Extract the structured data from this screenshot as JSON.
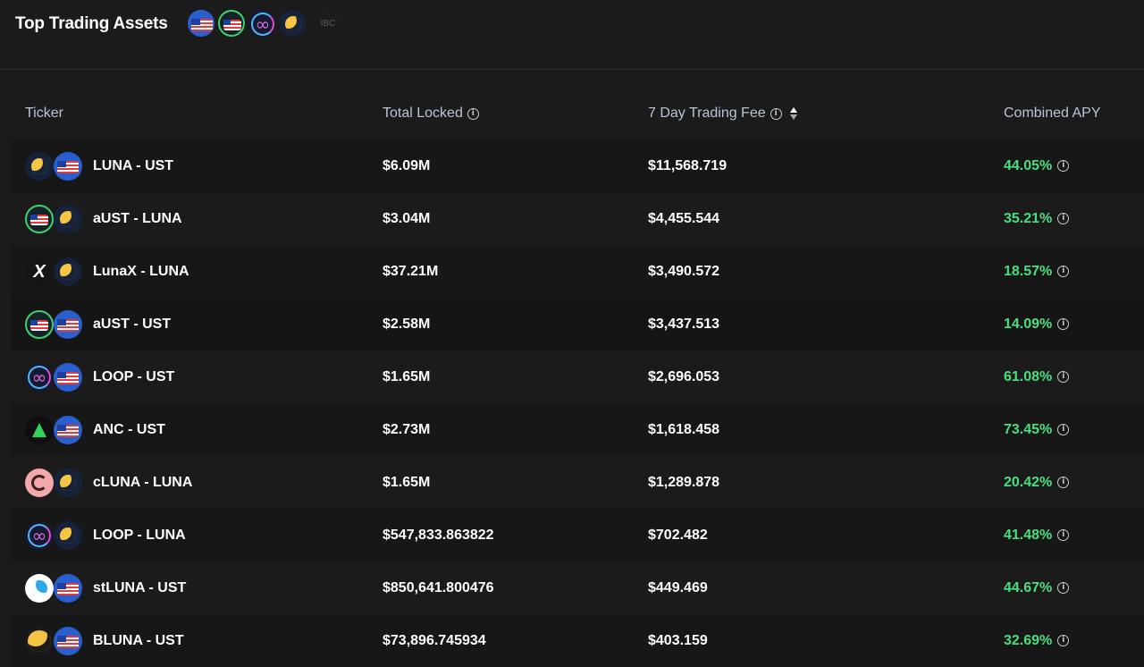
{
  "header": {
    "title": "Top Trading Assets",
    "icons": [
      "ust-icon",
      "aust-icon",
      "loop-icon",
      "luna-icon"
    ],
    "ibc_label": "IBC"
  },
  "table": {
    "columns": {
      "ticker": "Ticker",
      "total_locked": "Total Locked",
      "trading_fee": "7 Day Trading Fee",
      "combined_apy": "Combined APY"
    },
    "rows": [
      {
        "icons": [
          "luna",
          "ust"
        ],
        "ticker": "LUNA - UST",
        "total_locked": "$6.09M",
        "trading_fee": "$11,568.719",
        "apy": "44.05%"
      },
      {
        "icons": [
          "aust",
          "luna"
        ],
        "ticker": "aUST - LUNA",
        "total_locked": "$3.04M",
        "trading_fee": "$4,455.544",
        "apy": "35.21%"
      },
      {
        "icons": [
          "lunax",
          "luna"
        ],
        "ticker": "LunaX - LUNA",
        "total_locked": "$37.21M",
        "trading_fee": "$3,490.572",
        "apy": "18.57%"
      },
      {
        "icons": [
          "aust",
          "ust"
        ],
        "ticker": "aUST - UST",
        "total_locked": "$2.58M",
        "trading_fee": "$3,437.513",
        "apy": "14.09%"
      },
      {
        "icons": [
          "loop",
          "ust"
        ],
        "ticker": "LOOP - UST",
        "total_locked": "$1.65M",
        "trading_fee": "$2,696.053",
        "apy": "61.08%"
      },
      {
        "icons": [
          "anc",
          "ust"
        ],
        "ticker": "ANC - UST",
        "total_locked": "$2.73M",
        "trading_fee": "$1,618.458",
        "apy": "73.45%"
      },
      {
        "icons": [
          "cluna",
          "luna"
        ],
        "ticker": "cLUNA - LUNA",
        "total_locked": "$1.65M",
        "trading_fee": "$1,289.878",
        "apy": "20.42%"
      },
      {
        "icons": [
          "loop",
          "luna"
        ],
        "ticker": "LOOP - LUNA",
        "total_locked": "$547,833.863822",
        "trading_fee": "$702.482",
        "apy": "41.48%"
      },
      {
        "icons": [
          "stluna",
          "ust"
        ],
        "ticker": "stLUNA - UST",
        "total_locked": "$850,641.800476",
        "trading_fee": "$449.469",
        "apy": "44.67%"
      },
      {
        "icons": [
          "bluna",
          "ust"
        ],
        "ticker": "BLUNA - UST",
        "total_locked": "$73,896.745934",
        "trading_fee": "$403.159",
        "apy": "32.69%"
      }
    ]
  },
  "colors": {
    "background": "#1b1b1b",
    "apy_green": "#4ade80",
    "header_text": "#b9c4d8"
  }
}
